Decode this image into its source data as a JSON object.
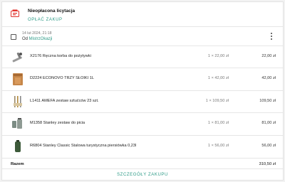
{
  "unpaid": {
    "title": "Nieopłacona licytacja",
    "pay_label": "OPŁAĆ ZAKUP",
    "icon": "unpaid-auction-icon"
  },
  "order": {
    "date": "14 lut 2024, 21:18",
    "seller_prefix": "Od ",
    "seller_name": "MistrzOkazji",
    "checkbox_checked": false
  },
  "items": [
    {
      "name": "X2176 Ręczna korba do pożytywki",
      "qty": "1 × 22,00 zł",
      "total": "22,00 zł",
      "thumb": "crank-thumb"
    },
    {
      "name": "D2224 ECONOVO TRZY SŁOIKI 1L",
      "qty": "1 × 42,00 zł",
      "total": "42,00 zł",
      "thumb": "jars-thumb"
    },
    {
      "name": "L1411 AMEFA zestaw sztućców 23 szt.",
      "qty": "1 × 109,50 zł",
      "total": "109,50 zł",
      "thumb": "cutlery-thumb"
    },
    {
      "name": "M1358 Stanley zestaw do picia",
      "qty": "1 × 81,00 zł",
      "total": "81,00 zł",
      "thumb": "drinkset-thumb"
    },
    {
      "name": "R6804 Stanley Classic Stalowa turystyczna piersiówka 0,23l",
      "qty": "1 × 56,00 zł",
      "total": "56,00 zł",
      "thumb": "flask-thumb"
    }
  ],
  "summary": {
    "label": "Razem",
    "total": "310,50 zł"
  },
  "footer": {
    "details_label": "SZCZEGÓŁY ZAKUPU"
  },
  "colors": {
    "accent": "#2c9a86",
    "alert": "#e0312b"
  }
}
